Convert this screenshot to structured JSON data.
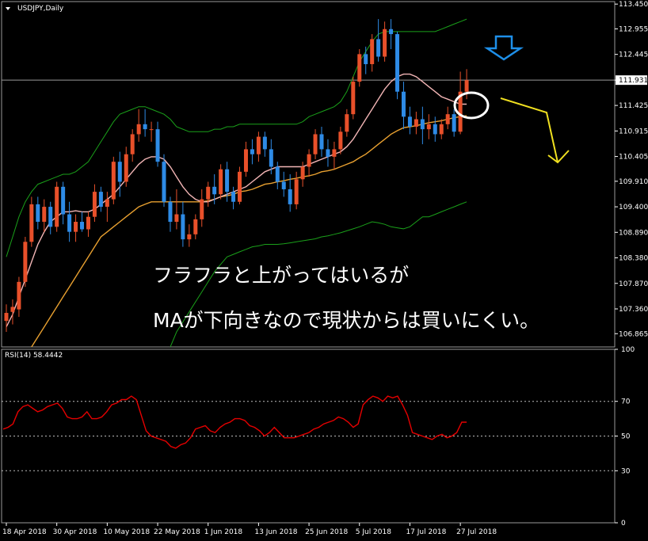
{
  "window": {
    "symbol_label": "USDJPY,Daily"
  },
  "annotation": {
    "line1": "フラフラと上がってはいるが",
    "line2": "MAが下向きなので現状からは買いにくい。"
  },
  "colors": {
    "background": "#000000",
    "grid": "#5a5a5a",
    "bull": "#e8502a",
    "bear": "#2e8be6",
    "bollinger": "#1aa01a",
    "ma_short": "#f2b5b5",
    "ma_long": "#e8a030",
    "rsi": "#e60000",
    "arrow_blue": "#1e8fe8",
    "arrow_yellow": "#f0e020",
    "circle": "#ffffff",
    "price_line": "#9a9a9a"
  },
  "chart_data": [
    {
      "type": "candlestick",
      "title": "USDJPY,Daily",
      "ylim": [
        106.6,
        113.5
      ],
      "price_ticks": [
        "113.450",
        "112.955",
        "112.445",
        "111.931",
        "111.425",
        "110.915",
        "110.405",
        "109.910",
        "109.400",
        "108.890",
        "108.380",
        "107.870",
        "107.360",
        "106.865"
      ],
      "current_price": "111.931",
      "date_labels": [
        "18 Apr 2018",
        "30 Apr 2018",
        "10 May 2018",
        "22 May 2018",
        "1 Jun 2018",
        "13 Jun 2018",
        "25 Jun 2018",
        "5 Jul 2018",
        "17 Jul 2018",
        "27 Jul 2018"
      ],
      "date_label_bar_index": [
        0,
        8,
        16,
        24,
        32,
        40,
        48,
        56,
        64,
        72
      ],
      "candles": [
        {
          "o": 107.12,
          "h": 107.45,
          "l": 106.9,
          "c": 107.28
        },
        {
          "o": 107.3,
          "h": 107.55,
          "l": 107.05,
          "c": 107.4
        },
        {
          "o": 107.35,
          "h": 108.0,
          "l": 107.2,
          "c": 107.9
        },
        {
          "o": 107.9,
          "h": 108.8,
          "l": 107.8,
          "c": 108.7
        },
        {
          "o": 108.7,
          "h": 109.6,
          "l": 108.6,
          "c": 109.45
        },
        {
          "o": 109.45,
          "h": 109.6,
          "l": 108.95,
          "c": 109.1
        },
        {
          "o": 109.1,
          "h": 109.55,
          "l": 108.9,
          "c": 109.4
        },
        {
          "o": 109.4,
          "h": 109.5,
          "l": 108.85,
          "c": 109.0
        },
        {
          "o": 109.0,
          "h": 109.9,
          "l": 108.9,
          "c": 109.8
        },
        {
          "o": 109.8,
          "h": 109.9,
          "l": 109.05,
          "c": 109.25
        },
        {
          "o": 109.25,
          "h": 109.5,
          "l": 108.7,
          "c": 108.9
        },
        {
          "o": 108.9,
          "h": 109.25,
          "l": 108.7,
          "c": 109.1
        },
        {
          "o": 109.1,
          "h": 109.3,
          "l": 108.9,
          "c": 108.95
        },
        {
          "o": 108.95,
          "h": 109.3,
          "l": 108.8,
          "c": 109.2
        },
        {
          "o": 109.2,
          "h": 109.85,
          "l": 109.1,
          "c": 109.7
        },
        {
          "o": 109.7,
          "h": 109.8,
          "l": 109.3,
          "c": 109.4
        },
        {
          "o": 109.4,
          "h": 109.7,
          "l": 109.1,
          "c": 109.55
        },
        {
          "o": 109.55,
          "h": 110.4,
          "l": 109.45,
          "c": 110.3
        },
        {
          "o": 110.3,
          "h": 110.5,
          "l": 109.6,
          "c": 109.9
        },
        {
          "o": 109.9,
          "h": 110.6,
          "l": 109.8,
          "c": 110.45
        },
        {
          "o": 110.45,
          "h": 110.95,
          "l": 110.3,
          "c": 110.85
        },
        {
          "o": 110.85,
          "h": 111.35,
          "l": 110.7,
          "c": 111.05
        },
        {
          "o": 111.05,
          "h": 111.35,
          "l": 110.8,
          "c": 110.95
        },
        {
          "o": 110.95,
          "h": 111.1,
          "l": 110.7,
          "c": 110.95
        },
        {
          "o": 110.95,
          "h": 111.1,
          "l": 110.2,
          "c": 110.3
        },
        {
          "o": 110.3,
          "h": 110.45,
          "l": 109.4,
          "c": 109.5
        },
        {
          "o": 109.5,
          "h": 109.6,
          "l": 108.9,
          "c": 109.1
        },
        {
          "o": 109.1,
          "h": 109.75,
          "l": 108.95,
          "c": 109.25
        },
        {
          "o": 109.25,
          "h": 109.5,
          "l": 108.6,
          "c": 108.75
        },
        {
          "o": 108.75,
          "h": 109.05,
          "l": 108.6,
          "c": 108.85
        },
        {
          "o": 108.85,
          "h": 109.25,
          "l": 108.75,
          "c": 109.15
        },
        {
          "o": 109.15,
          "h": 109.75,
          "l": 109.0,
          "c": 109.55
        },
        {
          "o": 109.55,
          "h": 109.9,
          "l": 109.4,
          "c": 109.8
        },
        {
          "o": 109.8,
          "h": 110.05,
          "l": 109.45,
          "c": 109.65
        },
        {
          "o": 109.65,
          "h": 110.25,
          "l": 109.55,
          "c": 110.15
        },
        {
          "o": 110.15,
          "h": 110.3,
          "l": 109.5,
          "c": 109.7
        },
        {
          "o": 109.7,
          "h": 109.8,
          "l": 109.35,
          "c": 109.5
        },
        {
          "o": 109.5,
          "h": 110.2,
          "l": 109.45,
          "c": 110.1
        },
        {
          "o": 110.1,
          "h": 110.7,
          "l": 110.0,
          "c": 110.55
        },
        {
          "o": 110.55,
          "h": 110.75,
          "l": 110.25,
          "c": 110.45
        },
        {
          "o": 110.45,
          "h": 110.9,
          "l": 110.3,
          "c": 110.8
        },
        {
          "o": 110.8,
          "h": 110.9,
          "l": 110.4,
          "c": 110.55
        },
        {
          "o": 110.55,
          "h": 110.75,
          "l": 110.05,
          "c": 110.2
        },
        {
          "o": 110.2,
          "h": 110.3,
          "l": 109.75,
          "c": 109.9
        },
        {
          "o": 109.9,
          "h": 110.1,
          "l": 109.6,
          "c": 109.75
        },
        {
          "o": 109.75,
          "h": 110.05,
          "l": 109.3,
          "c": 109.45
        },
        {
          "o": 109.45,
          "h": 110.1,
          "l": 109.35,
          "c": 109.95
        },
        {
          "o": 109.95,
          "h": 110.3,
          "l": 109.8,
          "c": 110.2
        },
        {
          "o": 110.2,
          "h": 110.55,
          "l": 110.0,
          "c": 110.45
        },
        {
          "o": 110.45,
          "h": 110.95,
          "l": 110.35,
          "c": 110.85
        },
        {
          "o": 110.85,
          "h": 111.0,
          "l": 110.4,
          "c": 110.55
        },
        {
          "o": 110.55,
          "h": 110.75,
          "l": 110.2,
          "c": 110.4
        },
        {
          "o": 110.4,
          "h": 110.7,
          "l": 110.15,
          "c": 110.55
        },
        {
          "o": 110.55,
          "h": 111.0,
          "l": 110.45,
          "c": 110.9
        },
        {
          "o": 110.9,
          "h": 111.35,
          "l": 110.8,
          "c": 111.25
        },
        {
          "o": 111.25,
          "h": 112.0,
          "l": 111.15,
          "c": 111.9
        },
        {
          "o": 111.9,
          "h": 112.55,
          "l": 111.8,
          "c": 112.45
        },
        {
          "o": 112.45,
          "h": 112.6,
          "l": 112.05,
          "c": 112.25
        },
        {
          "o": 112.25,
          "h": 112.85,
          "l": 112.1,
          "c": 112.75
        },
        {
          "o": 112.75,
          "h": 113.15,
          "l": 112.3,
          "c": 112.4
        },
        {
          "o": 112.4,
          "h": 113.1,
          "l": 112.3,
          "c": 112.95
        },
        {
          "o": 112.95,
          "h": 113.15,
          "l": 112.55,
          "c": 112.85
        },
        {
          "o": 112.85,
          "h": 112.9,
          "l": 111.55,
          "c": 111.7
        },
        {
          "o": 111.7,
          "h": 111.9,
          "l": 110.95,
          "c": 111.2
        },
        {
          "o": 111.2,
          "h": 111.4,
          "l": 110.85,
          "c": 111.0
        },
        {
          "o": 111.0,
          "h": 111.3,
          "l": 110.85,
          "c": 111.15
        },
        {
          "o": 111.15,
          "h": 111.4,
          "l": 110.65,
          "c": 110.95
        },
        {
          "o": 110.95,
          "h": 111.25,
          "l": 110.75,
          "c": 111.05
        },
        {
          "o": 111.05,
          "h": 111.2,
          "l": 110.7,
          "c": 110.85
        },
        {
          "o": 110.85,
          "h": 111.15,
          "l": 110.75,
          "c": 111.05
        },
        {
          "o": 111.05,
          "h": 111.4,
          "l": 110.95,
          "c": 111.25
        },
        {
          "o": 111.25,
          "h": 111.35,
          "l": 110.8,
          "c": 110.9
        },
        {
          "o": 110.9,
          "h": 112.1,
          "l": 110.85,
          "c": 111.7
        },
        {
          "o": 111.7,
          "h": 112.15,
          "l": 111.55,
          "c": 111.93
        }
      ],
      "bollinger_upper": [
        108.4,
        108.8,
        109.2,
        109.5,
        109.7,
        109.85,
        109.9,
        109.95,
        110.0,
        110.05,
        110.05,
        110.1,
        110.2,
        110.3,
        110.5,
        110.7,
        110.9,
        111.1,
        111.25,
        111.3,
        111.35,
        111.4,
        111.4,
        111.35,
        111.3,
        111.25,
        111.15,
        111.0,
        110.95,
        110.9,
        110.9,
        110.9,
        110.9,
        110.95,
        110.95,
        111.0,
        111.0,
        111.05,
        111.05,
        111.05,
        111.05,
        111.05,
        111.05,
        111.05,
        111.05,
        111.05,
        111.05,
        111.1,
        111.2,
        111.25,
        111.3,
        111.35,
        111.4,
        111.5,
        111.7,
        112.0,
        112.3,
        112.5,
        112.7,
        112.85,
        112.9,
        112.9,
        112.9,
        112.9,
        112.9,
        112.9,
        112.9,
        112.9,
        112.9,
        112.95,
        113.0,
        113.05,
        113.1,
        113.15
      ],
      "bollinger_lower": [
        105.6,
        105.6,
        105.6,
        105.6,
        105.6,
        105.6,
        105.6,
        105.6,
        105.6,
        105.6,
        105.6,
        105.6,
        105.6,
        105.6,
        105.6,
        105.6,
        105.6,
        105.6,
        105.6,
        105.6,
        105.6,
        105.6,
        105.6,
        105.6,
        105.6,
        105.6,
        106.6,
        106.9,
        107.1,
        107.3,
        107.5,
        107.7,
        107.9,
        108.1,
        108.25,
        108.4,
        108.45,
        108.5,
        108.55,
        108.6,
        108.62,
        108.65,
        108.65,
        108.65,
        108.66,
        108.68,
        108.7,
        108.72,
        108.74,
        108.76,
        108.8,
        108.82,
        108.85,
        108.88,
        108.92,
        108.96,
        109.0,
        109.05,
        109.1,
        109.08,
        109.05,
        109.0,
        108.98,
        108.96,
        109.0,
        109.1,
        109.2,
        109.2,
        109.25,
        109.3,
        109.35,
        109.4,
        109.45,
        109.5
      ],
      "ma_short": [
        107.0,
        107.25,
        107.6,
        107.95,
        108.3,
        108.65,
        108.9,
        109.1,
        109.2,
        109.3,
        109.3,
        109.32,
        109.3,
        109.3,
        109.35,
        109.45,
        109.55,
        109.65,
        109.8,
        109.95,
        110.1,
        110.25,
        110.35,
        110.4,
        110.4,
        110.35,
        110.2,
        110.0,
        109.8,
        109.65,
        109.55,
        109.5,
        109.5,
        109.55,
        109.6,
        109.65,
        109.7,
        109.75,
        109.8,
        109.9,
        110.0,
        110.1,
        110.15,
        110.2,
        110.2,
        110.2,
        110.2,
        110.2,
        110.25,
        110.3,
        110.35,
        110.4,
        110.45,
        110.5,
        110.6,
        110.75,
        110.95,
        111.15,
        111.35,
        111.55,
        111.75,
        111.9,
        112.0,
        112.05,
        112.05,
        112.0,
        111.9,
        111.8,
        111.7,
        111.6,
        111.55,
        111.5,
        111.45,
        111.45
      ],
      "ma_long": [
        105.8,
        106.0,
        106.2,
        106.4,
        106.6,
        106.8,
        107.0,
        107.2,
        107.4,
        107.6,
        107.8,
        108.0,
        108.2,
        108.4,
        108.6,
        108.8,
        108.9,
        109.0,
        109.1,
        109.2,
        109.3,
        109.4,
        109.45,
        109.5,
        109.5,
        109.5,
        109.5,
        109.5,
        109.5,
        109.5,
        109.5,
        109.5,
        109.52,
        109.55,
        109.6,
        109.62,
        109.65,
        109.7,
        109.72,
        109.75,
        109.8,
        109.85,
        109.87,
        109.9,
        109.92,
        109.95,
        109.97,
        110.0,
        110.02,
        110.05,
        110.1,
        110.12,
        110.15,
        110.2,
        110.25,
        110.3,
        110.38,
        110.45,
        110.55,
        110.65,
        110.75,
        110.85,
        110.92,
        110.98,
        111.0,
        111.02,
        111.05,
        111.08,
        111.1,
        111.12,
        111.15,
        111.18,
        111.2,
        111.22
      ]
    },
    {
      "type": "line",
      "title": "RSI(14) 58.4442",
      "ylim": [
        0,
        100
      ],
      "yticks": [
        "100",
        "70",
        "50",
        "30",
        "0"
      ],
      "levels": [
        70,
        50,
        30
      ],
      "series": [
        {
          "values": [
            54,
            55,
            57,
            64,
            67,
            68,
            66,
            64,
            65,
            67,
            68,
            69,
            66,
            61,
            60,
            60,
            61,
            64,
            60,
            60,
            61,
            64,
            68,
            69,
            71,
            71,
            73,
            71,
            62,
            53,
            50,
            49,
            48,
            47,
            44,
            43,
            45,
            46,
            49,
            54,
            55,
            56,
            53,
            52,
            55,
            57,
            58,
            60,
            60,
            59,
            56,
            55,
            53,
            50,
            52,
            55,
            52,
            49,
            49,
            49,
            50,
            51,
            52,
            54,
            55,
            57,
            58,
            59,
            61,
            60,
            58,
            55,
            57,
            68,
            71,
            73,
            72,
            70,
            73,
            72,
            73,
            68,
            62,
            52,
            51,
            50,
            49,
            48,
            50,
            51,
            49,
            50,
            52,
            58,
            58
          ]
        }
      ]
    }
  ]
}
